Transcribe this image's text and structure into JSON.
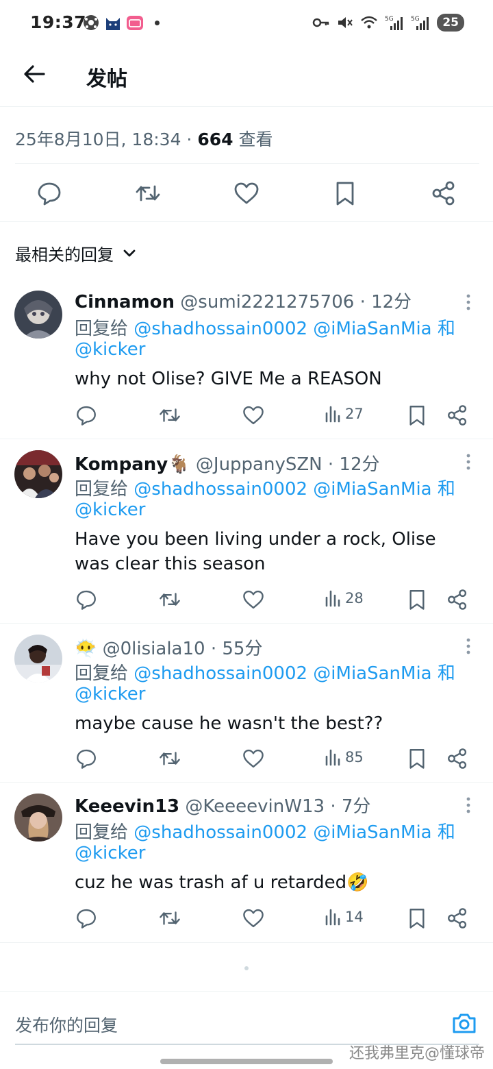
{
  "status_bar": {
    "time": "19:37",
    "battery": "25",
    "signal_1": "5G",
    "signal_2": "5G"
  },
  "header": {
    "title": "发帖"
  },
  "post_meta": {
    "date": "25年8月10日, 18:34",
    "separator": " · ",
    "views_count": "664",
    "views_label": " 查看"
  },
  "sort": {
    "label": "最相关的回复"
  },
  "replies": [
    {
      "name": "Cinnamon",
      "handle": "@sumi2221275706",
      "time": "· 12分",
      "reply_to_prefix": "回复给",
      "mention_1": "@shadhossain0002",
      "mention_2": "@iMiaSanMia",
      "conj": "和",
      "mention_3": "@kicker",
      "text": "why not Olise? GIVE Me a REASON",
      "views": "27"
    },
    {
      "name": "Kompany🐐",
      "handle": "@JuppanySZN",
      "time": "· 12分",
      "reply_to_prefix": "回复给",
      "mention_1": "@shadhossain0002",
      "mention_2": "@iMiaSanMia",
      "conj": "和",
      "mention_3": "@kicker",
      "text": "Have you been living under a rock, Olise was clear this season",
      "views": "28"
    },
    {
      "name": "😶‍🌫️",
      "handle": "@0lisiala10",
      "time": "· 55分",
      "reply_to_prefix": "回复给",
      "mention_1": "@shadhossain0002",
      "mention_2": "@iMiaSanMia",
      "conj": "和",
      "mention_3": "@kicker",
      "text": "maybe cause he wasn't the best??",
      "views": "85"
    },
    {
      "name": "Keeevin13",
      "handle": "@KeeeevinW13",
      "time": "· 7分",
      "reply_to_prefix": "回复给",
      "mention_1": "@shadhossain0002",
      "mention_2": "@iMiaSanMia",
      "conj": "和",
      "mention_3": "@kicker",
      "text": "cuz he was trash af u retarded🤣",
      "views": "14"
    }
  ],
  "composer": {
    "placeholder": "发布你的回复"
  },
  "watermark": "还我弗里克@懂球帝",
  "colors": {
    "accent": "#1d9bf0",
    "text_primary": "#0f1419",
    "text_secondary": "#536471",
    "divider": "#eff3f4"
  }
}
